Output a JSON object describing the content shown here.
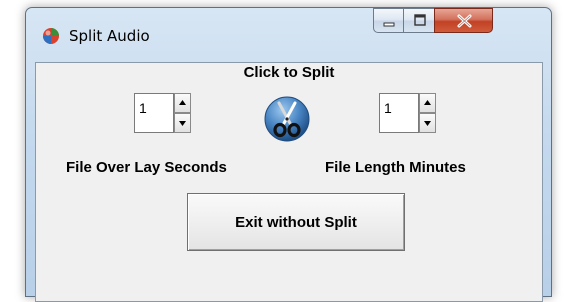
{
  "window": {
    "title": "Split Audio",
    "app_icon": "globe-app-icon",
    "controls": [
      "minimize-icon",
      "maximize-icon",
      "close-icon"
    ]
  },
  "form": {
    "heading": "Click to Split",
    "split_button_icon": "scissors-icon",
    "overlay": {
      "value": "1",
      "label": "File Over Lay Seconds"
    },
    "length": {
      "value": "1",
      "label": "File Length Minutes"
    },
    "exit_label": "Exit without Split"
  },
  "colors": {
    "close_button": "#c24125",
    "titlebar": "#c4d9ee",
    "client_bg": "#f0f0f0",
    "scissor_circle": "#3f7fb9"
  }
}
